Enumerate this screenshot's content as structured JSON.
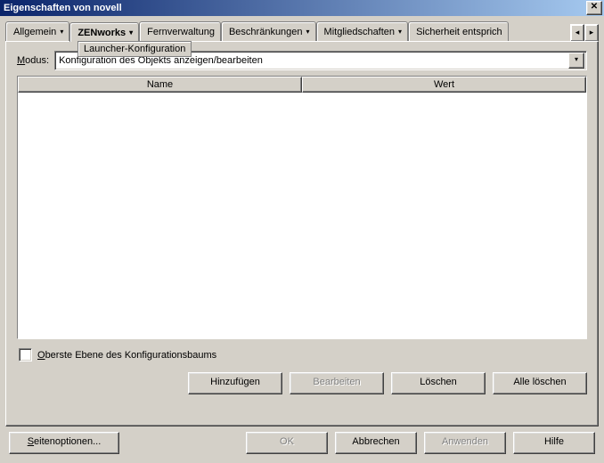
{
  "window": {
    "title": "Eigenschaften von novell"
  },
  "tabs": {
    "items": [
      {
        "label": "Allgemein",
        "hasDropdown": true
      },
      {
        "label": "ZENworks",
        "hasDropdown": true,
        "selected": true
      },
      {
        "label": "Fernverwaltung",
        "hasDropdown": false
      },
      {
        "label": "Beschränkungen",
        "hasDropdown": true
      },
      {
        "label": "Mitgliedschaften",
        "hasDropdown": true
      },
      {
        "label": "Sicherheit entsprich",
        "hasDropdown": false
      }
    ],
    "submenu": "Launcher-Konfiguration"
  },
  "panel": {
    "modeLabelPrefix": "M",
    "modeLabelRest": "odus:",
    "modeValue": "Konfiguration des Objekts anzeigen/bearbeiten",
    "columns": {
      "name": "Name",
      "value": "Wert"
    },
    "checkboxLabelPrefix": "O",
    "checkboxLabelRest": "berste Ebene des Konfigurationsbaums",
    "buttons": {
      "add": "Hinzufügen",
      "edit": "Bearbeiten",
      "delete": "Löschen",
      "deleteAll": "Alle löschen"
    }
  },
  "footer": {
    "pageOptionsPrefix": "S",
    "pageOptionsRest": "eitenoptionen...",
    "ok": "OK",
    "cancel": "Abbrechen",
    "apply": "Anwenden",
    "help": "Hilfe"
  }
}
